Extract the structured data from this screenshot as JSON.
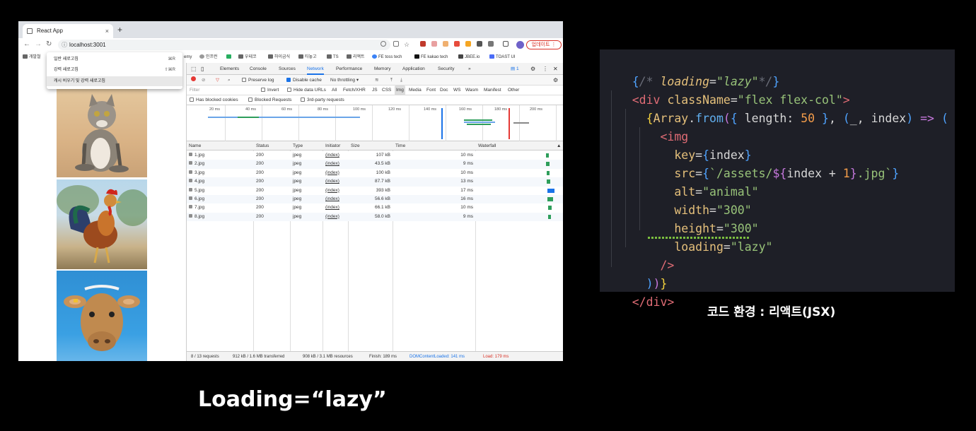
{
  "browser": {
    "tab_title": "React App",
    "tab_close": "×",
    "new_tab": "+",
    "url": "localhost:3001",
    "update_label": "업데이트 ⋮",
    "bookmarks": [
      "개발철",
      "emy",
      "인프런",
      "우테코",
      "하이금식",
      "티놓고",
      "TS",
      "리액트",
      "FE toss tech",
      "FE kakao tech",
      "JBEE.io",
      "TOAST UI"
    ],
    "reload_menu": [
      {
        "label": "일반 새로고침",
        "shortcut": "⌘R"
      },
      {
        "label": "강력 새로고침",
        "shortcut": "⇧⌘R"
      },
      {
        "label": "캐시 비우기 및 강력 새로고침",
        "shortcut": ""
      }
    ]
  },
  "devtools": {
    "tabs": [
      "Elements",
      "Console",
      "Sources",
      "Network",
      "Performance",
      "Memory",
      "Application",
      "Security",
      "»"
    ],
    "active_tab": "Network",
    "badge": "1",
    "toolbar": {
      "preserve_log": "Preserve log",
      "disable_cache": "Disable cache",
      "throttling": "No throttling"
    },
    "filter": {
      "placeholder": "Filter",
      "invert": "Invert",
      "hide_data_urls": "Hide data URLs",
      "types": [
        "All",
        "Fetch/XHR",
        "JS",
        "CSS",
        "Img",
        "Media",
        "Font",
        "Doc",
        "WS",
        "Wasm",
        "Manifest",
        "Other"
      ],
      "active_type": "Img"
    },
    "blocked": {
      "has_blocked_cookies": "Has blocked cookies",
      "blocked_requests": "Blocked Requests",
      "third_party": "3rd-party requests"
    },
    "overview_ticks": [
      "20 ms",
      "40 ms",
      "60 ms",
      "80 ms",
      "100 ms",
      "120 ms",
      "140 ms",
      "160 ms",
      "180 ms",
      "200 ms"
    ],
    "columns": [
      "Name",
      "Status",
      "Type",
      "Initiator",
      "Size",
      "Time",
      "Waterfall"
    ],
    "rows": [
      {
        "name": "1.jpg",
        "status": "200",
        "type": "jpeg",
        "initiator": "(index)",
        "size": "107 kB",
        "time": "10 ms"
      },
      {
        "name": "2.jpg",
        "status": "200",
        "type": "jpeg",
        "initiator": "(index)",
        "size": "43.5 kB",
        "time": "9 ms"
      },
      {
        "name": "3.jpg",
        "status": "200",
        "type": "jpeg",
        "initiator": "(index)",
        "size": "100 kB",
        "time": "10 ms"
      },
      {
        "name": "4.jpg",
        "status": "200",
        "type": "jpeg",
        "initiator": "(index)",
        "size": "87.7 kB",
        "time": "13 ms"
      },
      {
        "name": "5.jpg",
        "status": "200",
        "type": "jpeg",
        "initiator": "(index)",
        "size": "393 kB",
        "time": "17 ms"
      },
      {
        "name": "6.jpg",
        "status": "200",
        "type": "jpeg",
        "initiator": "(index)",
        "size": "56.6 kB",
        "time": "16 ms"
      },
      {
        "name": "7.jpg",
        "status": "200",
        "type": "jpeg",
        "initiator": "(index)",
        "size": "66.1 kB",
        "time": "10 ms"
      },
      {
        "name": "8.jpg",
        "status": "200",
        "type": "jpeg",
        "initiator": "(index)",
        "size": "58.0 kB",
        "time": "9 ms"
      }
    ],
    "status_bar": {
      "requests": "8 / 13 requests",
      "transferred": "912 kB / 1.6 MB transferred",
      "resources": "908 kB / 3.1 MB resources",
      "finish": "Finish: 189 ms",
      "dcl": "DOMContentLoaded: 141 ms",
      "load": "Load: 179 ms"
    }
  },
  "code": {
    "lines": [
      "{/* loading=\"lazy\"*/}",
      "<div className=\"flex flex-col\">",
      "  {Array.from({ length: 50 }, (_, index) => (",
      "    <img",
      "      key={index}",
      "      src={`/assets/${index + 1}.jpg`}",
      "      alt=\"animal\"",
      "      width=\"300\"",
      "      height=\"300\"",
      "      loading=\"lazy\"",
      "    />",
      "  ))}",
      "</div>"
    ]
  },
  "captions": {
    "code_env": "코드 환경 : 리액트(JSX)",
    "main": "Loading=“lazy”"
  },
  "colors": {
    "accent": "#1a73e8",
    "code_bg": "#1e1f27",
    "string": "#98c379",
    "tag": "#e06c75",
    "attr": "#e5c07b"
  }
}
